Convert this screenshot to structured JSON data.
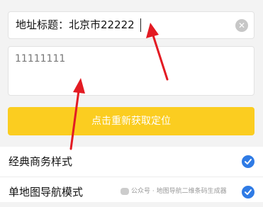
{
  "address_title": {
    "label": "地址标题：",
    "value": "北京市22222"
  },
  "address_detail": {
    "value": "11111111"
  },
  "relocate_button": {
    "label": "点击重新获取定位"
  },
  "style_list": [
    {
      "label": "经典商务样式",
      "selected": true
    },
    {
      "label": "单地图导航模式",
      "selected": true
    }
  ],
  "watermark": {
    "text": "公众号 · 地图导航二维条码生成器"
  },
  "colors": {
    "accent_yellow": "#fbcd20",
    "check_blue": "#2f7be5",
    "arrow_red": "#e31b23"
  },
  "icons": {
    "clear": "close-circle-icon",
    "check": "check-circle-icon"
  }
}
